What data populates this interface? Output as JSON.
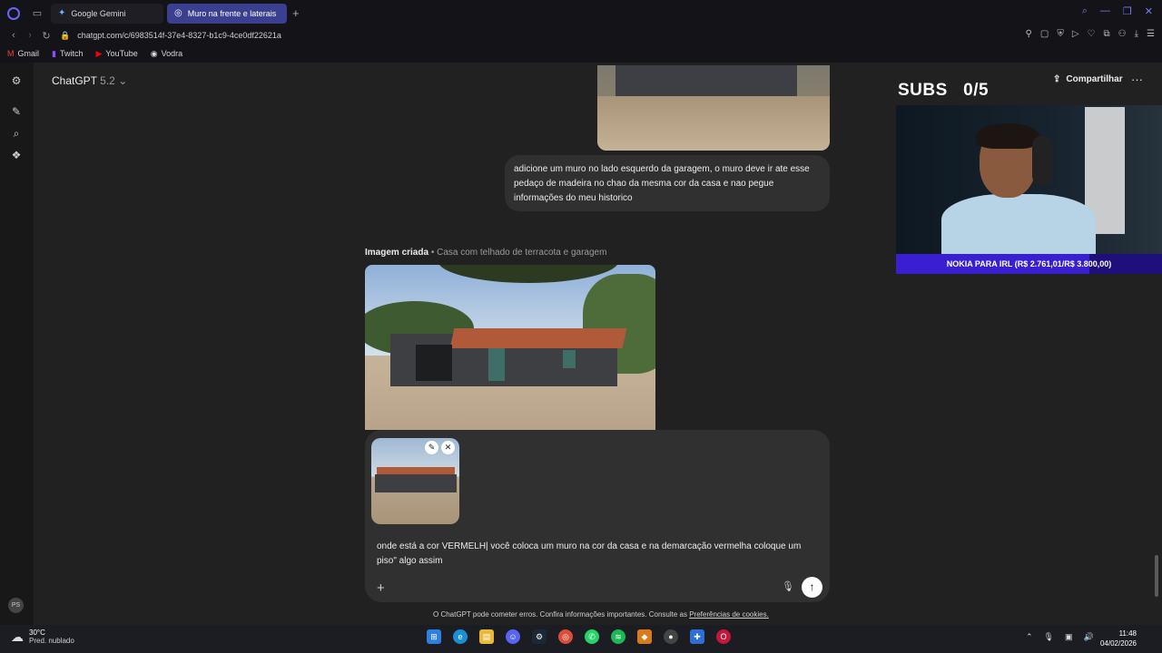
{
  "browser": {
    "tabs": [
      {
        "label": "Google Gemini",
        "active": false
      },
      {
        "label": "Muro na frente e laterais",
        "active": true
      }
    ],
    "url": "chatgpt.com/c/6983514f-37e4-8327-b1c9-4ce0df22621a",
    "bookmarks": [
      "Gmail",
      "Twitch",
      "YouTube",
      "Vodra"
    ]
  },
  "header": {
    "model_name": "ChatGPT",
    "model_version": "5.2",
    "share_label": "Compartilhar"
  },
  "conversation": {
    "user_message": "adicione um muro no lado esquerdo da garagem, o muro deve ir ate esse pedaço de madeira no chao da mesma cor da casa e nao pegue informações do meu historico",
    "image_caption_bold": "Imagem criada",
    "image_caption_sub": "• Casa com telhado de terracota e garagem"
  },
  "composer": {
    "text": "onde está a cor VERMELH| você coloca um muro na cor da casa e na demarcação vermelha coloque um piso\" algo assim",
    "disclaimer": "O ChatGPT pode cometer erros. Confira informações importantes. Consulte as",
    "disclaimer_link": "Preferências de cookies."
  },
  "overlay": {
    "subs_label": "SUBS",
    "subs_count": "0/5",
    "banner_text": "NOKIA PARA IRL (R$ 2.761,01/R$ 3.800,00)",
    "banner_progress": 0.7266
  },
  "taskbar": {
    "temperature": "30°C",
    "weather": "Pred. nublado",
    "time": "11:48",
    "date": "04/02/2026",
    "apps": [
      "windows-start",
      "edge",
      "file-explorer",
      "discord",
      "steam",
      "chrome",
      "whatsapp",
      "spotify",
      "app-orange",
      "app-red",
      "app-blue",
      "opera-gx"
    ]
  },
  "user_avatar_initials": "PS"
}
